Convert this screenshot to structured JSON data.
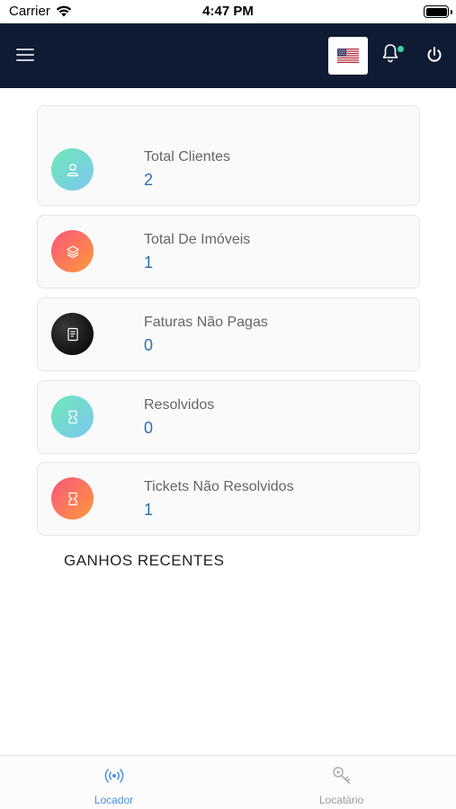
{
  "status_bar": {
    "carrier": "Carrier",
    "time": "4:47 PM"
  },
  "header": {
    "menu_icon": "hamburger-menu-icon",
    "language_flag": "us-flag-icon",
    "notification_icon": "bell-icon",
    "notification_dot_color": "#3fd0a8",
    "power_icon": "power-icon",
    "background_color": "#0e1b33"
  },
  "cards": [
    {
      "label": "Total Clientes",
      "value": "2",
      "icon": "user-icon",
      "style": "teal"
    },
    {
      "label": "Total De Imóveis",
      "value": "1",
      "icon": "layers-icon",
      "style": "orange"
    },
    {
      "label": "Faturas Não Pagas",
      "value": "0",
      "icon": "invoice-icon",
      "style": "dark"
    },
    {
      "label": "Resolvidos",
      "value": "0",
      "icon": "ticket-icon",
      "style": "teal"
    },
    {
      "label": "Tickets Não Resolvidos",
      "value": "1",
      "icon": "ticket-icon",
      "style": "orange"
    }
  ],
  "section": {
    "title": "GANHOS RECENTES"
  },
  "tab_bar": {
    "tabs": [
      {
        "label": "Locador",
        "icon": "broadcast-icon",
        "active": true
      },
      {
        "label": "Locatário",
        "icon": "key-icon",
        "active": false
      }
    ],
    "active_color": "#4a90e2",
    "inactive_color": "#9b9b9b"
  }
}
